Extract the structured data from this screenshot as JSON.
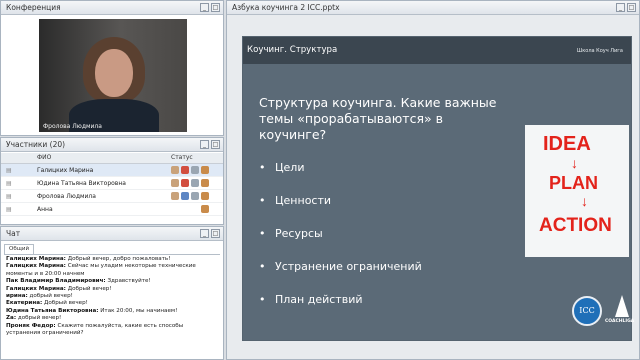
{
  "conference": {
    "title": "Конференция",
    "speaker_name": "Фролова Людмила"
  },
  "participants": {
    "title": "Участники (20)",
    "columns": {
      "name": "ФИО",
      "status": "Статус"
    },
    "rows": [
      {
        "name": "Галицких Марина"
      },
      {
        "name": "Юдина Татьяна Викторовна"
      },
      {
        "name": "Фролова Людмила"
      },
      {
        "name": "Анна"
      }
    ]
  },
  "chat": {
    "title": "Чат",
    "tab": "Общий",
    "messages": [
      {
        "author": "Галицких Марина:",
        "text": "Добрый вечер, добро пожаловать!"
      },
      {
        "author": "Галицких Марина:",
        "text": "Сейчас мы уладим некоторые технические моменты и в 20:00 начнем"
      },
      {
        "author": "Пак Владимир  Владимирович:",
        "text": "Здравствуйте!"
      },
      {
        "author": "Галицких Марина:",
        "text": "Добрый вечер!"
      },
      {
        "author": "ирина:",
        "text": "добрый вечер!"
      },
      {
        "author": "Екатерина:",
        "text": "Добрый вечер!"
      },
      {
        "author": "Юдина Татьяна Викторовна:",
        "text": "Итак 20:00, мы начинаем!"
      },
      {
        "author": "Za:",
        "text": "добрый вечер!"
      },
      {
        "author": "Проняк Федор:",
        "text": "Скажите пожалуйста, какие есть способы устранения ограничений?"
      }
    ]
  },
  "presentation": {
    "title": "Азбука коучинга 2 ICC.pptx",
    "slide": {
      "header": "Коучинг. Структура",
      "brand": "Школа Коуч Лига",
      "heading": "Структура коучинга. Какие важные темы «прорабатываются» в коучинге?",
      "bullets": [
        "Цели",
        "Ценности",
        "Ресурсы",
        "Устранение ограничений",
        "План действий"
      ],
      "image_words": [
        "IDEA",
        "PLAN",
        "ACTION"
      ],
      "logo_icc": "ICC",
      "logo_coachliga": "COACHLIGA"
    }
  },
  "colors": {
    "slide_bg": "#5b6a77",
    "slide_header": "#3b4650",
    "idea_red": "#e3231b"
  }
}
